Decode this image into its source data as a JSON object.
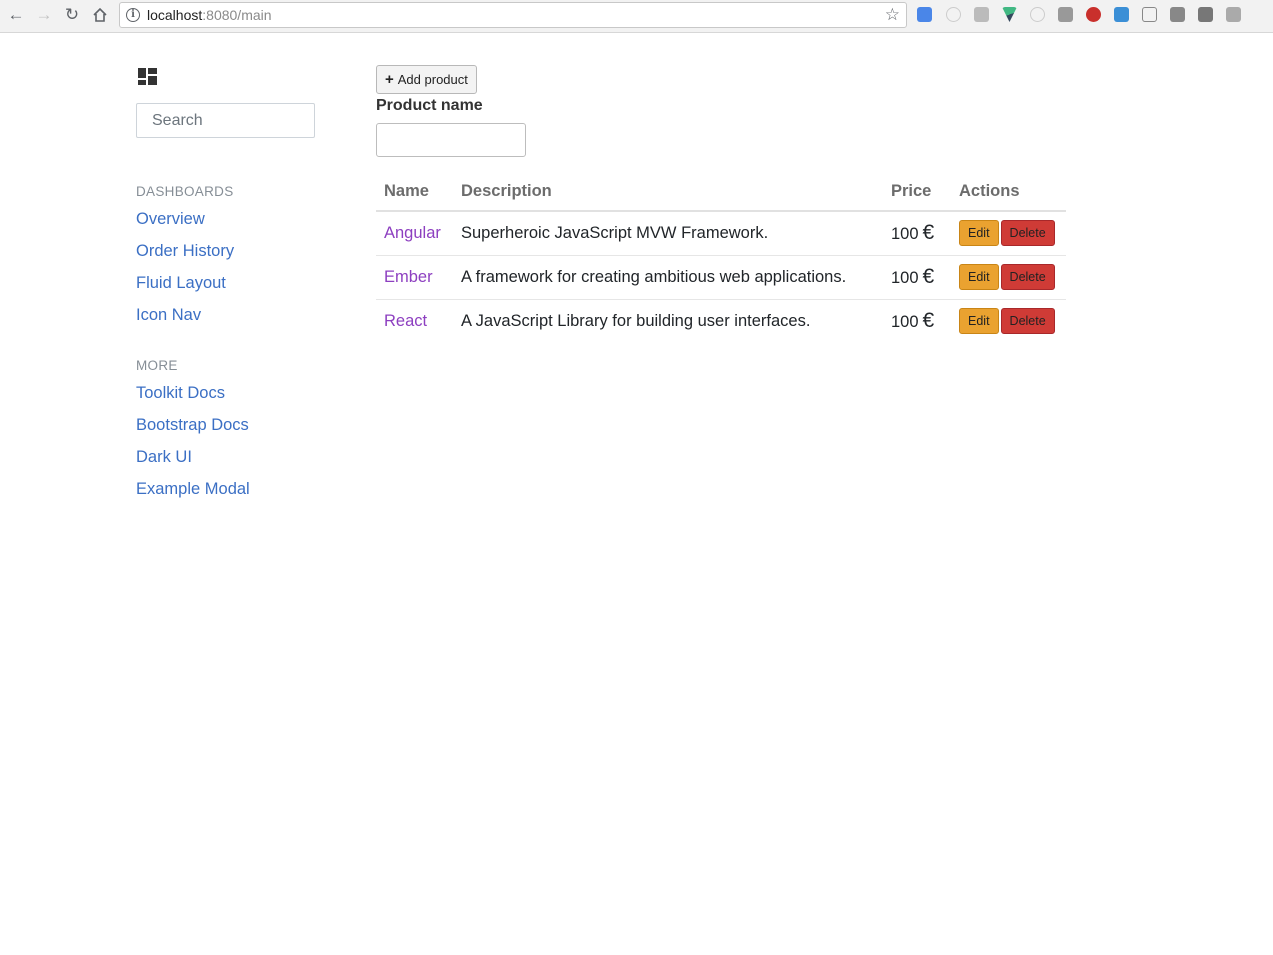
{
  "browser": {
    "url_host": "localhost",
    "url_rest": ":8080/main"
  },
  "sidebar": {
    "search_placeholder": "Search",
    "sections": [
      {
        "header": "DASHBOARDS",
        "links": [
          "Overview",
          "Order History",
          "Fluid Layout",
          "Icon Nav"
        ]
      },
      {
        "header": "MORE",
        "links": [
          "Toolkit Docs",
          "Bootstrap Docs",
          "Dark UI",
          "Example Modal"
        ]
      }
    ]
  },
  "main": {
    "add_button_label": "Add product",
    "product_name_label": "Product name",
    "table": {
      "headers": [
        "Name",
        "Description",
        "Price",
        "Actions"
      ],
      "rows": [
        {
          "name": "Angular",
          "description": "Superheroic JavaScript MVW Framework.",
          "price": "100",
          "currency": "€"
        },
        {
          "name": "Ember",
          "description": "A framework for creating ambitious web applications.",
          "price": "100",
          "currency": "€"
        },
        {
          "name": "React",
          "description": "A JavaScript Library for building user interfaces.",
          "price": "100",
          "currency": "€"
        }
      ],
      "edit_label": "Edit",
      "delete_label": "Delete"
    }
  },
  "colors": {
    "link_blue": "#3b6fc4",
    "name_purple": "#8d3fc0",
    "edit_orange": "#eaa230",
    "delete_red": "#cf3b36"
  }
}
